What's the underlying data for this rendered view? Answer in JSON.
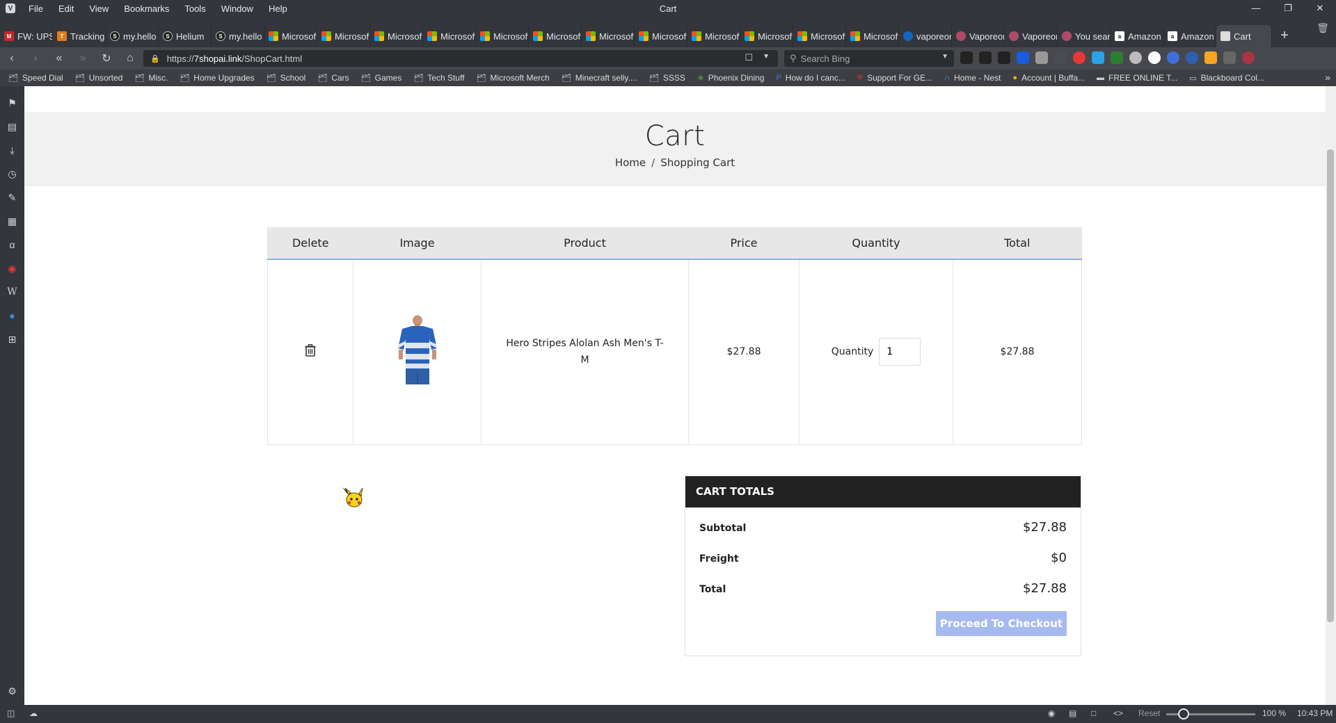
{
  "browser": {
    "window_title": "Cart",
    "menu": [
      "File",
      "Edit",
      "View",
      "Bookmarks",
      "Tools",
      "Window",
      "Help"
    ],
    "tabs": [
      {
        "label": "FW: UPS",
        "icon": "gmail-icon"
      },
      {
        "label": "Tracking",
        "icon": "tracking-icon"
      },
      {
        "label": "my.hello",
        "icon": "sg-icon"
      },
      {
        "label": "Helium",
        "icon": "sg-icon"
      },
      {
        "label": "my.hello",
        "icon": "sg-icon"
      },
      {
        "label": "Microsoft",
        "icon": "microsoft-icon"
      },
      {
        "label": "Microsoft",
        "icon": "microsoft-icon"
      },
      {
        "label": "Microsoft",
        "icon": "microsoft-icon"
      },
      {
        "label": "Microsoft",
        "icon": "microsoft-icon"
      },
      {
        "label": "Microsoft",
        "icon": "microsoft-icon"
      },
      {
        "label": "Microsoft",
        "icon": "microsoft-icon"
      },
      {
        "label": "Microsoft",
        "icon": "microsoft-icon"
      },
      {
        "label": "Microsoft",
        "icon": "microsoft-icon"
      },
      {
        "label": "Microsoft",
        "icon": "microsoft-icon"
      },
      {
        "label": "Microsoft",
        "icon": "microsoft-icon"
      },
      {
        "label": "Microsoft",
        "icon": "microsoft-icon"
      },
      {
        "label": "Microsoft",
        "icon": "microsoft-icon"
      },
      {
        "label": "vaporeon",
        "icon": "search-icon"
      },
      {
        "label": "Vaporeon",
        "icon": "vaporeon-icon"
      },
      {
        "label": "Vaporeon",
        "icon": "vaporeon-icon"
      },
      {
        "label": "You search",
        "icon": "vaporeon-icon"
      },
      {
        "label": "Amazon",
        "icon": "amazon-icon"
      },
      {
        "label": "Amazon",
        "icon": "amazon-icon"
      },
      {
        "label": "Cart",
        "icon": "document-icon",
        "active": true
      }
    ],
    "url_prefix": "https://",
    "url_host": "7shopai.link",
    "url_path": "/ShopCart.html",
    "search_placeholder": "Search Bing",
    "bookmarks": [
      "Speed Dial",
      "Unsorted",
      "Misc.",
      "Home Upgrades",
      "School",
      "Cars",
      "Games",
      "Tech Stuff",
      "Microsoft Merch",
      "Minecraft selly....",
      "SSSS",
      "Phoenix Dining",
      "How do I canc...",
      "Support For GE...",
      "Home - Nest",
      "Account | Buffa...",
      "FREE ONLINE T...",
      "Blackboard Col..."
    ],
    "status": {
      "reset": "Reset",
      "zoom": "100 %",
      "time": "10:43 PM"
    }
  },
  "page": {
    "title": "Cart",
    "breadcrumb": {
      "home": "Home",
      "sep": "/",
      "current": "Shopping Cart"
    },
    "table": {
      "headers": [
        "Delete",
        "Image",
        "Product",
        "Price",
        "Quantity",
        "Total"
      ],
      "rows": [
        {
          "product": "Hero Stripes Alolan Ash Men's T-M",
          "price": "$27.88",
          "qty_label": "Quantity",
          "qty_value": "1",
          "total": "$27.88"
        }
      ]
    },
    "totals": {
      "heading": "CART TOTALS",
      "subtotal_label": "Subtotal",
      "subtotal_value": "$27.88",
      "freight_label": "Freight",
      "freight_value": "$0",
      "total_label": "Total",
      "total_value": "$27.88",
      "checkout_label": "Proceed To Checkout"
    }
  },
  "colors": {
    "accent": "#a7baf0",
    "header_rule": "#8db0ea",
    "totals_head": "#222222"
  }
}
